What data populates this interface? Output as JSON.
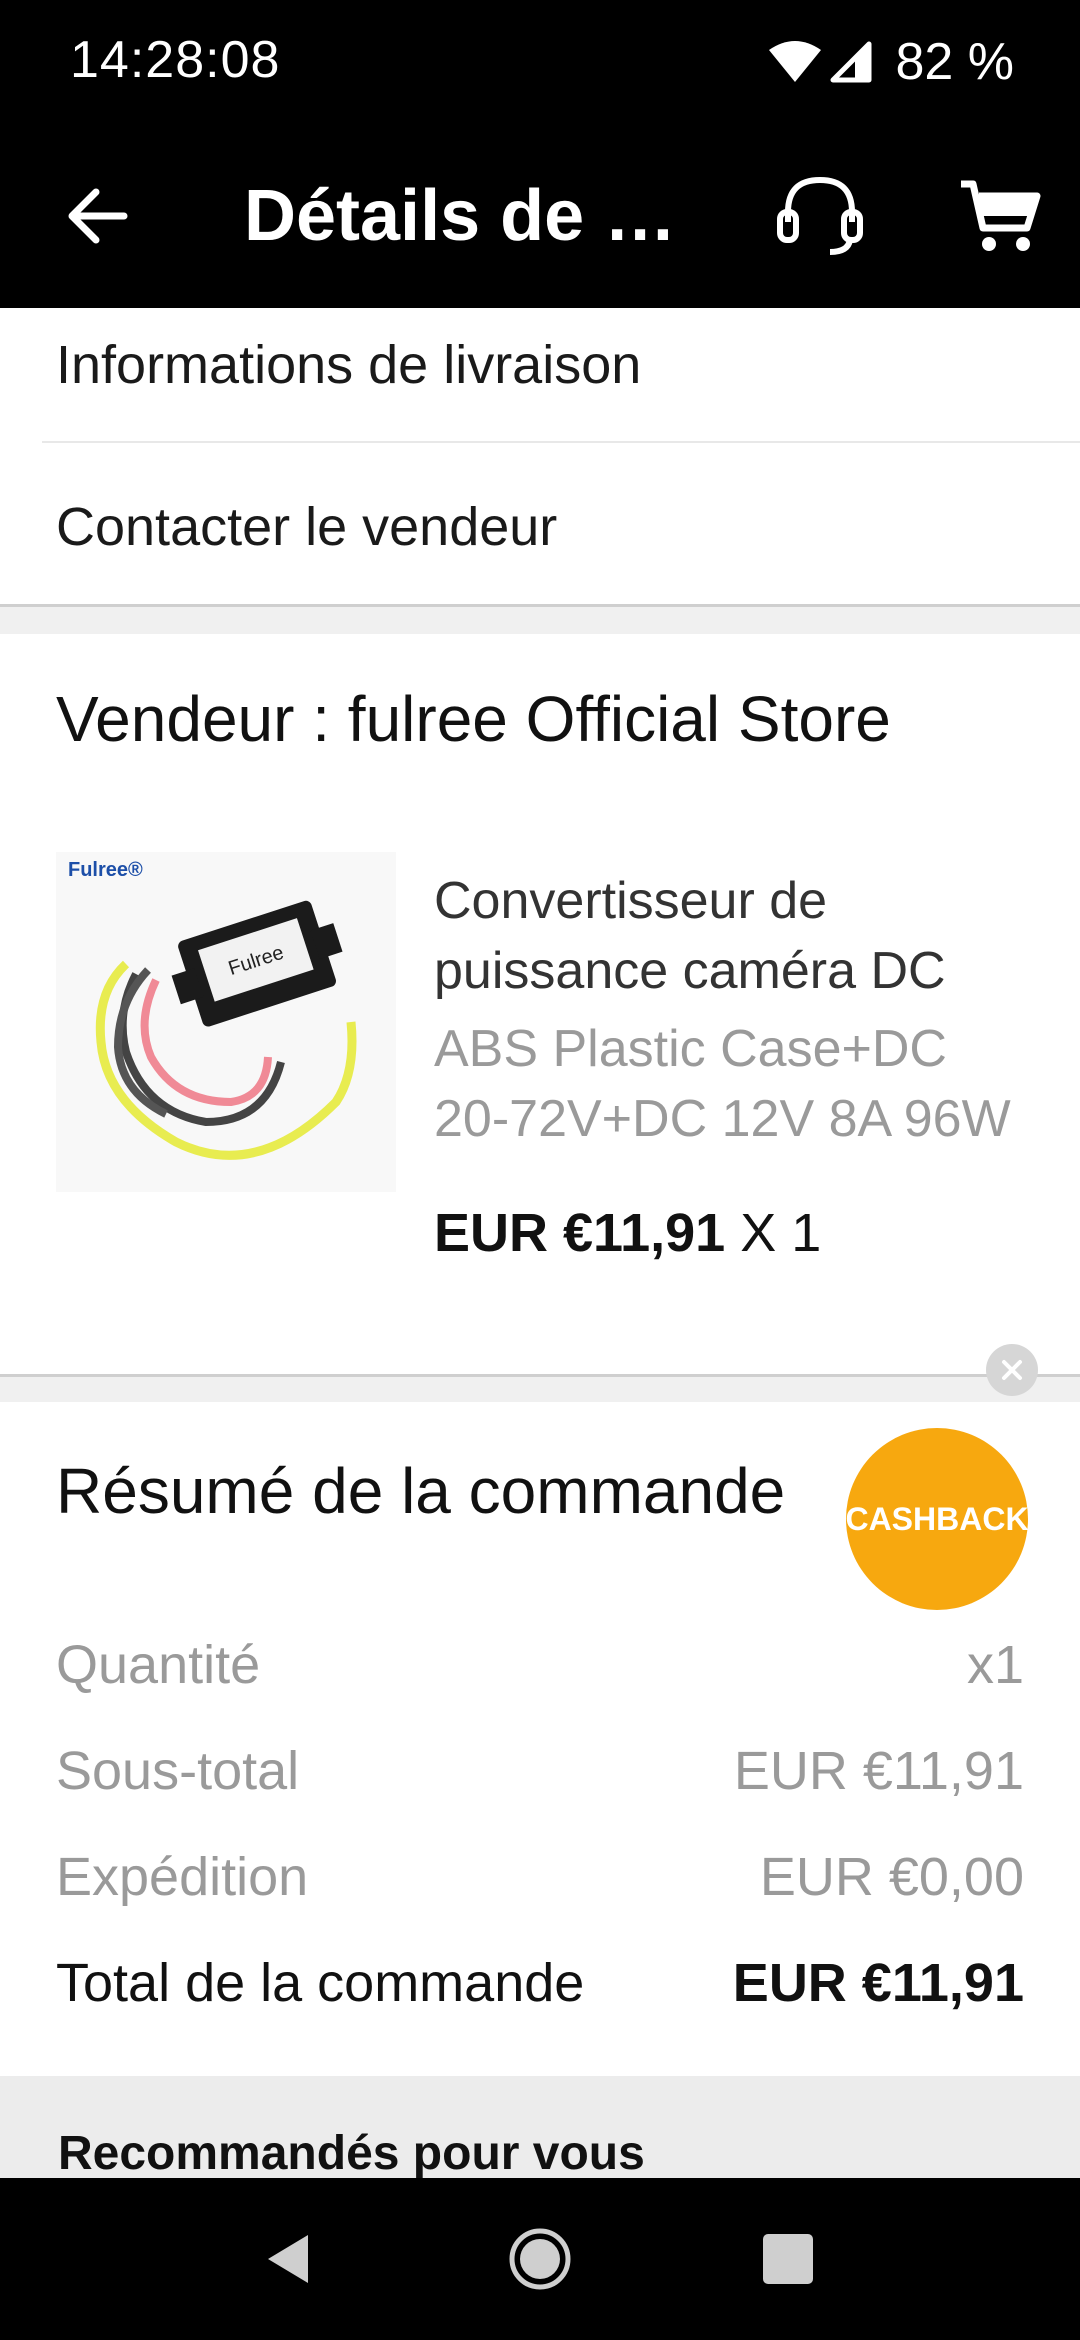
{
  "status_bar": {
    "time": "14:28:08",
    "battery": "82 %"
  },
  "app_bar": {
    "title": "Détails de la commande",
    "icons": [
      "arrow-back-icon",
      "headset-icon",
      "shopping-cart-icon"
    ]
  },
  "menu": {
    "delivery_info": "Informations de livraison",
    "contact_seller": "Contacter le vendeur"
  },
  "seller": {
    "title": "Vendeur : fulree Official Store",
    "product": {
      "brand_logo": "Fulree®",
      "device_label": "Fulree",
      "name": "Convertisseur de puissance caméra DC",
      "variant": "ABS Plastic Case+DC 20-72V+DC 12V 8A 96W",
      "price": "EUR €11,91",
      "quantity": "X 1"
    }
  },
  "summary": {
    "title": "Résumé de la commande",
    "cashback": "CASHBACK",
    "rows": [
      {
        "label": "Quantité",
        "value": "x1"
      },
      {
        "label": "Sous-total",
        "value": "EUR €11,91"
      },
      {
        "label": "Expédition",
        "value": "EUR €0,00"
      }
    ],
    "total": {
      "label": "Total de la commande",
      "value": "EUR €11,91"
    }
  },
  "recommendations": {
    "title": "Recommandés pour vous"
  },
  "colors": {
    "cashback_orange": "#f7a80f",
    "bar_black": "#000000",
    "muted_text": "#9a9a9a"
  }
}
